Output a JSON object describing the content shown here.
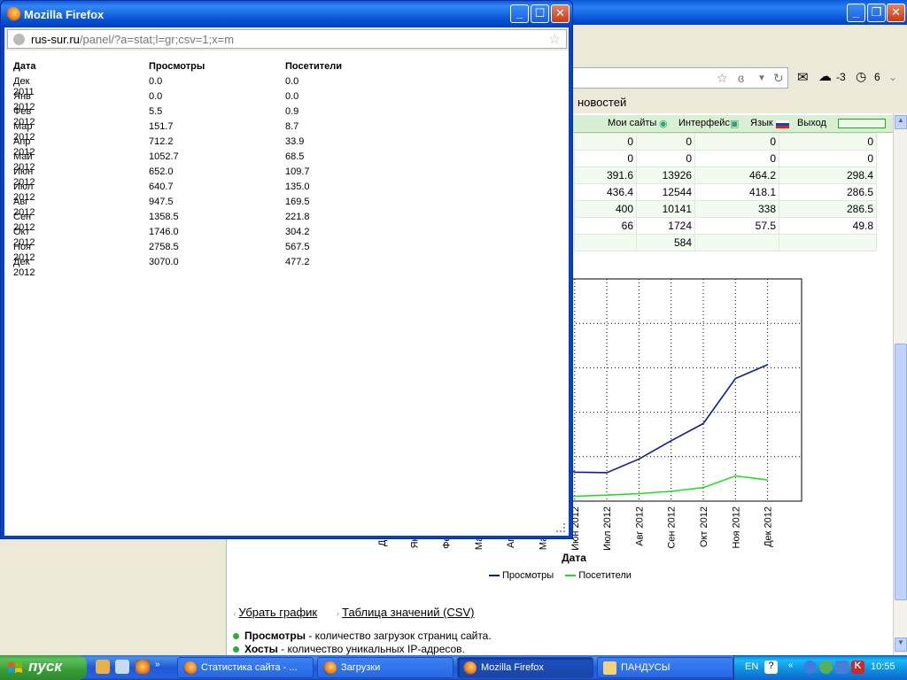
{
  "popup": {
    "title": "Mozilla Firefox",
    "url_host": "rus-sur.ru",
    "url_path": "/panel/?a=stat;l=gr;csv=1;x=m",
    "headers": [
      "Дата",
      "Просмотры",
      "Посетители"
    ],
    "rows": [
      [
        "Дек 2011",
        "0.0",
        "0.0"
      ],
      [
        "Янв 2012",
        "0.0",
        "0.0"
      ],
      [
        "Фев 2012",
        "5.5",
        "0.9"
      ],
      [
        "Мар 2012",
        "151.7",
        "8.7"
      ],
      [
        "Апр 2012",
        "712.2",
        "33.9"
      ],
      [
        "Май 2012",
        "1052.7",
        "68.5"
      ],
      [
        "Июн 2012",
        "652.0",
        "109.7"
      ],
      [
        "Июл 2012",
        "640.7",
        "135.0"
      ],
      [
        "Авг 2012",
        "947.5",
        "169.5"
      ],
      [
        "Сен 2012",
        "1358.5",
        "221.8"
      ],
      [
        "Окт 2012",
        "1746.0",
        "304.2"
      ],
      [
        "Ноя 2012",
        "2758.5",
        "567.5"
      ],
      [
        "Дек 2012",
        "3070.0",
        "477.2"
      ]
    ]
  },
  "bg": {
    "weather": "-3",
    "mail_count": "6",
    "news": "новостей",
    "nav": {
      "my_sites": "Мои сайты",
      "interface": "Интерфейс",
      "language": "Язык",
      "logout": "Выход"
    },
    "table": [
      [
        "0",
        "0",
        "0",
        "0"
      ],
      [
        "0",
        "0",
        "0",
        "0"
      ],
      [
        "391.6",
        "13926",
        "464.2",
        "298.4"
      ],
      [
        "436.4",
        "12544",
        "418.1",
        "286.5"
      ],
      [
        "400",
        "10141",
        "338",
        "286.5"
      ],
      [
        "66",
        "1724",
        "57.5",
        "49.8"
      ],
      [
        "",
        "584",
        "",
        ""
      ]
    ],
    "chart_xlabel": "Дата",
    "chart_xticks": [
      "Дек 2011",
      "Янв 2012",
      "Фев 2012",
      "Мар 2012",
      "Апр 2012",
      "Май 2012",
      "Июн 2012",
      "Июл 2012",
      "Авг 2012",
      "Сен 2012",
      "Окт 2012",
      "Ноя 2012",
      "Дек 2012"
    ],
    "legend": [
      "Просмотры",
      "Посетители"
    ],
    "links": [
      "Убрать график",
      "Таблица значений (CSV)"
    ],
    "desc": [
      {
        "term": "Просмотры",
        "text": " - количество загрузок страниц сайта."
      },
      {
        "term": "Хосты",
        "text": " - количество уникальных IP-адресов."
      }
    ]
  },
  "chart_data": {
    "type": "line",
    "categories": [
      "Дек 2011",
      "Янв 2012",
      "Фев 2012",
      "Мар 2012",
      "Апр 2012",
      "Май 2012",
      "Июн 2012",
      "Июл 2012",
      "Авг 2012",
      "Сен 2012",
      "Окт 2012",
      "Ноя 2012",
      "Дек 2012"
    ],
    "series": [
      {
        "name": "Просмотры",
        "color": "#0c1aa0",
        "values": [
          0.0,
          0.0,
          5.5,
          151.7,
          712.2,
          1052.7,
          652.0,
          640.7,
          947.5,
          1358.5,
          1746.0,
          2758.5,
          3070.0
        ]
      },
      {
        "name": "Посетители",
        "color": "#22dd22",
        "values": [
          0.0,
          0.0,
          0.9,
          8.7,
          33.9,
          68.5,
          109.7,
          135.0,
          169.5,
          221.8,
          304.2,
          567.5,
          477.2
        ]
      }
    ],
    "xlabel": "Дата",
    "ylim": [
      0,
      5000
    ],
    "grid": true,
    "legend": "bottom"
  },
  "taskbar": {
    "start": "пуск",
    "tasks": [
      "Статистика сайта - ...",
      "Загрузки",
      "Mozilla Firefox",
      "ПАНДУСЫ"
    ],
    "lang": "EN",
    "clock": "10:55"
  }
}
